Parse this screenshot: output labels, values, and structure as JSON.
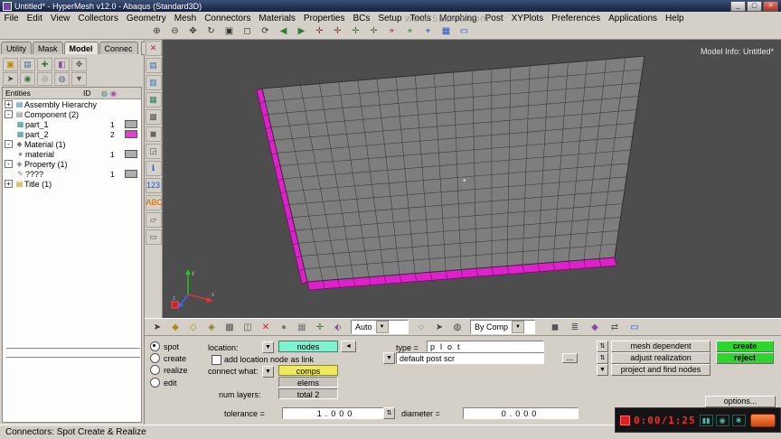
{
  "window": {
    "title": "Untitled* - HyperMesh v12.0 - Abaqus (Standard3D)",
    "minimize": "_",
    "maximize": "▢",
    "close": "✕"
  },
  "menu": {
    "items": [
      {
        "name": "menu-item-file",
        "label": "File"
      },
      {
        "name": "menu-item-edit",
        "label": "Edit"
      },
      {
        "name": "menu-item-view",
        "label": "View"
      },
      {
        "name": "menu-item-collectors",
        "label": "Collectors"
      },
      {
        "name": "menu-item-geometry",
        "label": "Geometry"
      },
      {
        "name": "menu-item-mesh",
        "label": "Mesh"
      },
      {
        "name": "menu-item-connectors",
        "label": "Connectors"
      },
      {
        "name": "menu-item-materials",
        "label": "Materials"
      },
      {
        "name": "menu-item-properties",
        "label": "Properties"
      },
      {
        "name": "menu-item-bcs",
        "label": "BCs"
      },
      {
        "name": "menu-item-setup",
        "label": "Setup"
      },
      {
        "name": "menu-item-tools",
        "label": "Tools"
      },
      {
        "name": "menu-item-morphing",
        "label": "Morphing"
      },
      {
        "name": "menu-item-post",
        "label": "Post"
      },
      {
        "name": "menu-item-xyplots",
        "label": "XYPlots"
      },
      {
        "name": "menu-item-preferences",
        "label": "Preferences"
      },
      {
        "name": "menu-item-applications",
        "label": "Applications"
      },
      {
        "name": "menu-item-help",
        "label": "Help"
      }
    ]
  },
  "toolbar": {
    "icons": [
      {
        "name": "zoom-in-icon",
        "glyph": "⊕",
        "color": "#333"
      },
      {
        "name": "zoom-out-icon",
        "glyph": "⊖",
        "color": "#333"
      },
      {
        "name": "pan-icon",
        "glyph": "✥",
        "color": "#333"
      },
      {
        "name": "rotate-view-icon",
        "glyph": "↻",
        "color": "#333"
      },
      {
        "name": "fit-view-icon",
        "glyph": "▣",
        "color": "#333"
      },
      {
        "name": "zoom-window-icon",
        "glyph": "◻",
        "color": "#333"
      },
      {
        "name": "dynamic-rotate-icon",
        "glyph": "⟳",
        "color": "#333"
      },
      {
        "name": "prev-view-icon",
        "glyph": "◀",
        "color": "#2a7f2a"
      },
      {
        "name": "next-view-icon",
        "glyph": "▶",
        "color": "#2a7f2a"
      },
      {
        "name": "xy-plane-view-icon",
        "glyph": "✛",
        "color": "#cc2222"
      },
      {
        "name": "yz-plane-view-icon",
        "glyph": "✛",
        "color": "#cc2222"
      },
      {
        "name": "xz-plane-view-icon",
        "glyph": "✛",
        "color": "#228822"
      },
      {
        "name": "iso-view-icon",
        "glyph": "✛",
        "color": "#228822"
      },
      {
        "name": "triad-left-icon",
        "glyph": "⌖",
        "color": "#cc2222"
      },
      {
        "name": "triad-right-icon",
        "glyph": "⌖",
        "color": "#228822"
      },
      {
        "name": "triad-top-icon",
        "glyph": "⌖",
        "color": "#2255cc"
      },
      {
        "name": "display-options-icon",
        "glyph": "▦",
        "color": "#2255cc"
      },
      {
        "name": "screen-capture-icon",
        "glyph": "▭",
        "color": "#2255cc"
      }
    ]
  },
  "left_tabs": {
    "items": [
      "Utility",
      "Mask",
      "Model",
      "Connec"
    ],
    "scroll_left": "◄",
    "scroll_right": "►"
  },
  "left_toolbar_row1": {
    "icons": [
      {
        "name": "create-collector-icon",
        "glyph": "▣",
        "color": "#b8860b"
      },
      {
        "name": "component-view-icon",
        "glyph": "▤",
        "color": "#3a6ea5"
      },
      {
        "name": "add-entity-icon",
        "glyph": "✚",
        "color": "#2a7f2a"
      },
      {
        "name": "color-mode-icon",
        "glyph": "◧",
        "color": "#8a4aa5"
      },
      {
        "name": "expand-tree-icon",
        "glyph": "✥",
        "color": "#555"
      }
    ]
  },
  "left_toolbar_row2": {
    "icons": [
      {
        "name": "select-pointer-icon",
        "glyph": "➤",
        "color": "#444"
      },
      {
        "name": "show-icon",
        "glyph": "◉",
        "color": "#2a7f2a"
      },
      {
        "name": "hide-icon",
        "glyph": "◎",
        "color": "#888"
      },
      {
        "name": "isolate-icon",
        "glyph": "◍",
        "color": "#3a6ea5"
      },
      {
        "name": "filter-icon",
        "glyph": "▼",
        "color": "#555"
      }
    ]
  },
  "tree": {
    "header": {
      "entities": "Entities",
      "id": "ID"
    },
    "header_icons": [
      {
        "name": "global-display-icon",
        "glyph": "◍",
        "color": "#2a8a8a"
      },
      {
        "name": "palette-icon",
        "glyph": "◉",
        "color": "#a54aa5"
      }
    ],
    "rows": [
      {
        "expand": "+",
        "icon": "▤",
        "label": "Assembly Hierarchy"
      },
      {
        "expand": "-",
        "icon": "▤",
        "label": "Component (2)"
      },
      {
        "icon": "▦",
        "label": "part_1",
        "id": "1",
        "swatch": "background:#adadad"
      },
      {
        "icon": "▦",
        "label": "part_2",
        "id": "2",
        "swatch": "background:#e23fd0"
      },
      {
        "expand": "-",
        "icon": "◆",
        "label": "Material (1)"
      },
      {
        "icon": "●",
        "label": "material",
        "id": "1",
        "swatch": "background:#adadad"
      },
      {
        "expand": "-",
        "icon": "◈",
        "label": "Property (1)"
      },
      {
        "icon": "✎",
        "label": "????",
        "id": "1",
        "swatch": "background:#adadad"
      },
      {
        "expand": "+",
        "icon": "▤",
        "label": "Title (1)"
      }
    ]
  },
  "vstrip": {
    "icons": [
      {
        "name": "close-panel-icon",
        "glyph": "✕",
        "color": "#c22"
      },
      {
        "name": "view-page1-icon",
        "glyph": "▤",
        "color": "#3a6ea5"
      },
      {
        "name": "view-page2-icon",
        "glyph": "▥",
        "color": "#3a6ea5"
      },
      {
        "name": "view-page3-icon",
        "glyph": "▦",
        "color": "#2a7f5f"
      },
      {
        "name": "view-wireframe-icon",
        "glyph": "▩",
        "color": "#555"
      },
      {
        "name": "view-shaded-icon",
        "glyph": "◼",
        "color": "#666"
      },
      {
        "name": "view-section-icon",
        "glyph": "◲",
        "color": "#555"
      },
      {
        "name": "info-icon",
        "glyph": "ℹ",
        "color": "#2255cc"
      },
      {
        "name": "numbers-icon",
        "glyph": "123",
        "color": "#2255cc"
      },
      {
        "name": "labels-icon",
        "glyph": "ABC",
        "color": "#cc6a00"
      },
      {
        "name": "measure-icon",
        "glyph": "▱",
        "color": "#555"
      },
      {
        "name": "note-icon",
        "glyph": "▭",
        "color": "#555"
      }
    ]
  },
  "viewport": {
    "model_info": "Model Info: Untitled*",
    "watermark": "www.51zxw.com",
    "mesh_fill": "#7e7e7e",
    "mesh_line": "#3d3d3d",
    "edge_magenta": "#dd22cc",
    "background": "#4d4d4d"
  },
  "dispbar": {
    "icons_left": [
      {
        "name": "select-arrow-icon",
        "glyph": "➤",
        "color": "#333"
      },
      {
        "name": "shaded-geometry-icon",
        "glyph": "◆",
        "color": "#b8860b"
      },
      {
        "name": "wireframe-geometry-icon",
        "glyph": "◇",
        "color": "#b8860b"
      },
      {
        "name": "hidden-line-icon",
        "glyph": "◈",
        "color": "#8a7a2a"
      },
      {
        "name": "mask-icon",
        "glyph": "▩",
        "color": "#555"
      },
      {
        "name": "unmask-icon",
        "glyph": "◫",
        "color": "#555"
      },
      {
        "name": "clear-mask-icon",
        "glyph": "✕",
        "color": "#c22"
      },
      {
        "name": "shaded-elements-icon",
        "glyph": "●",
        "color": "#777"
      },
      {
        "name": "mesh-lines-icon",
        "glyph": "▦",
        "color": "#777"
      },
      {
        "name": "feature-lines-icon",
        "glyph": "✛",
        "color": "#2a7f2a"
      }
    ],
    "auto_combo": {
      "value": "Auto"
    },
    "icons_mid": [
      {
        "name": "spline-display-icon",
        "glyph": "◌",
        "color": "#444"
      },
      {
        "name": "vector-display-icon",
        "glyph": "➤",
        "color": "#444"
      },
      {
        "name": "sphere-display-icon",
        "glyph": "◍",
        "color": "#444"
      }
    ],
    "bycomp_combo": {
      "value": "By Comp"
    },
    "icons_right": [
      {
        "name": "solid-cube-icon",
        "glyph": "◼",
        "color": "#555"
      },
      {
        "name": "layers-icon",
        "glyph": "≣",
        "color": "#555"
      },
      {
        "name": "diamond-icon",
        "glyph": "◆",
        "color": "#8a4aa5"
      },
      {
        "name": "swap-icon",
        "glyph": "⇄",
        "color": "#555"
      },
      {
        "name": "monitor-icon",
        "glyph": "▭",
        "color": "#2255cc"
      }
    ]
  },
  "panel": {
    "modes": [
      "spot",
      "create",
      "realize",
      "edit"
    ],
    "selected_mode": "spot",
    "location_label": "location:",
    "location_value": "nodes",
    "location_switch": "◄",
    "dropdown_glyph": "▼",
    "cycle_glyph": "⇅",
    "add_link_label": "add location node as link",
    "connect_what_label": "connect what:",
    "connect_value_1": "comps",
    "connect_value_2": "elems",
    "num_layers_label": "num layers:",
    "num_layers_value": "total 2",
    "tolerance_label": "tolerance =",
    "tolerance_value": "1.000",
    "type_label": "type =",
    "type_value": "plot",
    "post_script_value": "default post scr",
    "browse_label": "...",
    "diameter_label": "diameter =",
    "diameter_value": "0.000",
    "mesh_dependent_label": "mesh dependent",
    "adjust_realization_label": "adjust realization",
    "project_find_label": "project and find nodes",
    "create_label": "create",
    "reject_label": "reject",
    "options_label": "options...",
    "highlight_color": "#7df2cc",
    "yellow_color": "#efe95f",
    "green_color": "#2fd42f"
  },
  "recorder": {
    "time": "0:00/1:25",
    "icons": [
      {
        "name": "pause-icon",
        "glyph": "▮▮"
      },
      {
        "name": "camera-icon",
        "glyph": "◉"
      },
      {
        "name": "settings-icon",
        "glyph": "✱"
      }
    ]
  },
  "status": {
    "text": "Connectors: Spot Create & Realize"
  }
}
